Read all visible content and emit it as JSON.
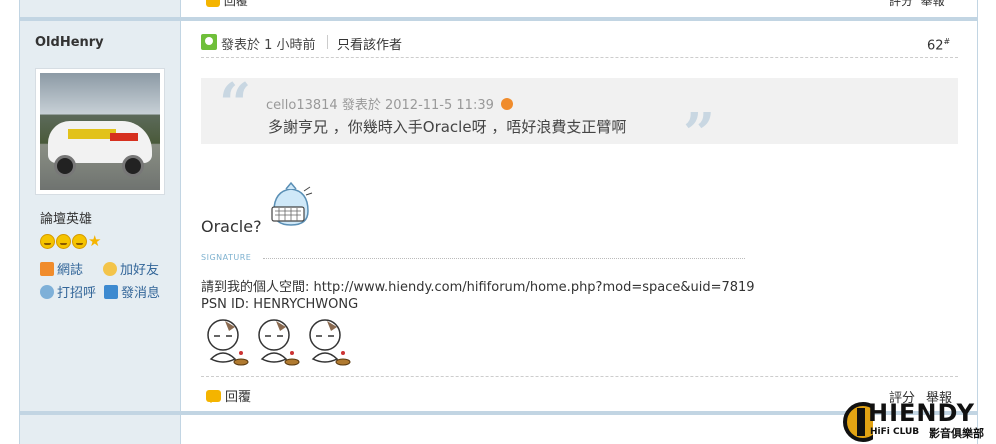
{
  "previous_post": {
    "reply_label": "回覆",
    "rate_label": "評分",
    "report_label": "舉報"
  },
  "author": {
    "name": "OldHenry",
    "rank": "論壇英雄",
    "links": {
      "blog": "網誌",
      "add_friend": "加好友",
      "greet": "打招呼",
      "message": "發消息"
    }
  },
  "post": {
    "meta": "發表於 1 小時前",
    "only_author": "只看該作者",
    "floor": "62",
    "floor_mark": "#",
    "quote": {
      "author": "cello13814",
      "posted_label": "發表於",
      "date": "2012-11-5 11:39",
      "text": "多謝亨兄 ，你幾時入手Oracle呀 ，唔好浪費支正臂啊"
    },
    "content": "Oracle?",
    "signature": {
      "label": "SIGNATURE",
      "line1": "請到我的個人空間: http://www.hiendy.com/hififorum/home.php?mod=space&uid=7819",
      "line2": "PSN ID: HENRYCHWONG"
    },
    "actions": {
      "reply": "回覆",
      "rate": "評分",
      "report": "舉報"
    }
  },
  "logo": {
    "main": "HIENDY",
    "sub": "HiFi CLUB",
    "cn": "影音俱樂部"
  },
  "colors": {
    "sidebar_bg": "#e5edf2",
    "border": "#c2d5e3",
    "link": "#336699",
    "quote_bg": "#f1f1f1"
  }
}
